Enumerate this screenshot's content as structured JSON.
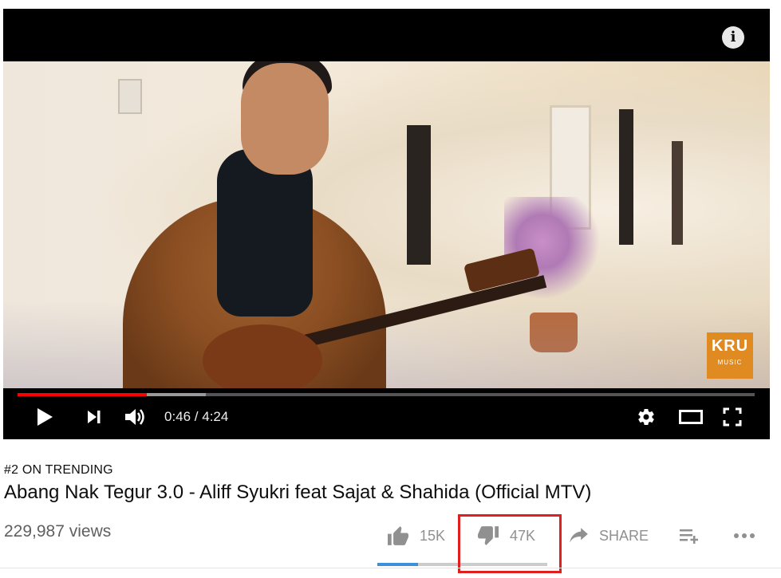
{
  "player": {
    "current_time": "0:46",
    "duration": "4:24",
    "time_display": "0:46 / 4:24",
    "progress_played": 0.175,
    "progress_loaded": 0.255,
    "watermark_logo": "KRU",
    "watermark_sub": "MUSIC",
    "colors": {
      "played_bar": "#ff0000",
      "watermark_bg": "#e08a22"
    },
    "icons": {
      "info": "info-icon",
      "play": "play-icon",
      "next": "next-icon",
      "volume": "volume-icon",
      "settings": "gear-icon",
      "theater": "theater-mode-icon",
      "fullscreen": "fullscreen-icon"
    }
  },
  "video": {
    "trending_badge": "#2 ON TRENDING",
    "title": "Abang Nak Tegur 3.0 - Aliff Syukri feat Sajat & Shahida (Official MTV)",
    "views": "229,987 views"
  },
  "actions": {
    "like_count": "15K",
    "dislike_count": "47K",
    "share_label": "SHARE",
    "like_ratio": 0.24,
    "icons": {
      "like": "thumbs-up-icon",
      "dislike": "thumbs-down-icon",
      "share": "share-arrow-icon",
      "add_to_playlist": "add-to-playlist-icon",
      "more": "more-horizontal-icon"
    },
    "colors": {
      "like_bar": "#3e8ede",
      "highlight": "#e0201e"
    }
  }
}
